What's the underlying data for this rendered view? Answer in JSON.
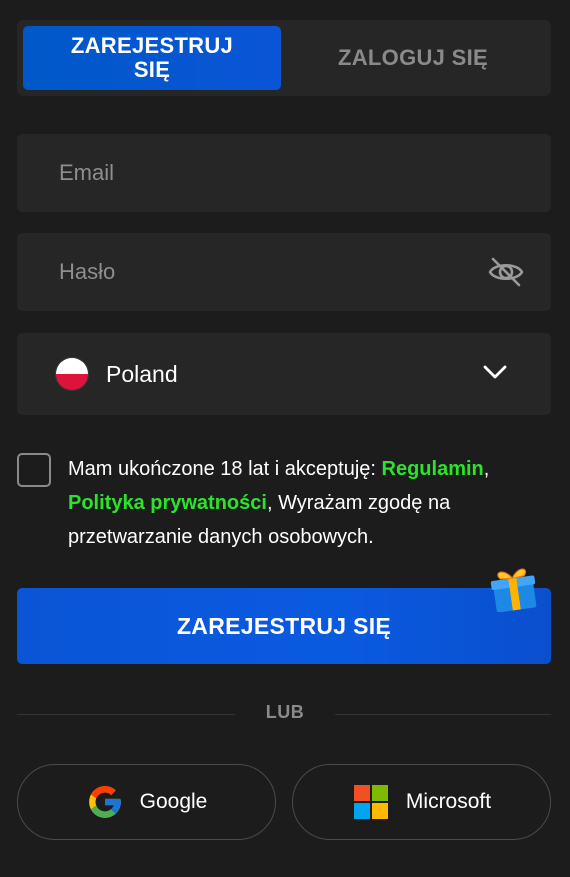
{
  "tabs": {
    "register_label": "ZAREJESTRUJ SIĘ",
    "login_label": "ZALOGUJ SIĘ"
  },
  "form": {
    "email_placeholder": "Email",
    "password_placeholder": "Hasło",
    "country": "Poland"
  },
  "agreement": {
    "text_before": "Mam ukończone 18 lat i akceptuję: ",
    "terms_link": "Regulamin",
    "separator": ",",
    "privacy_link": "Polityka prywatności",
    "text_after": ", Wyrażam zgodę na przetwarzanie danych osobowych."
  },
  "submit_label": "ZAREJESTRUJ SIĘ",
  "divider_label": "LUB",
  "social": {
    "google_label": "Google",
    "microsoft_label": "Microsoft"
  },
  "colors": {
    "accent_blue": "#0a55d6",
    "link_green": "#2be32b",
    "background": "#1c1c1c",
    "field_bg": "#262626"
  },
  "icons": [
    "eye-off-icon",
    "poland-flag-icon",
    "chevron-down-icon",
    "gift-icon",
    "google-icon",
    "microsoft-icon"
  ]
}
